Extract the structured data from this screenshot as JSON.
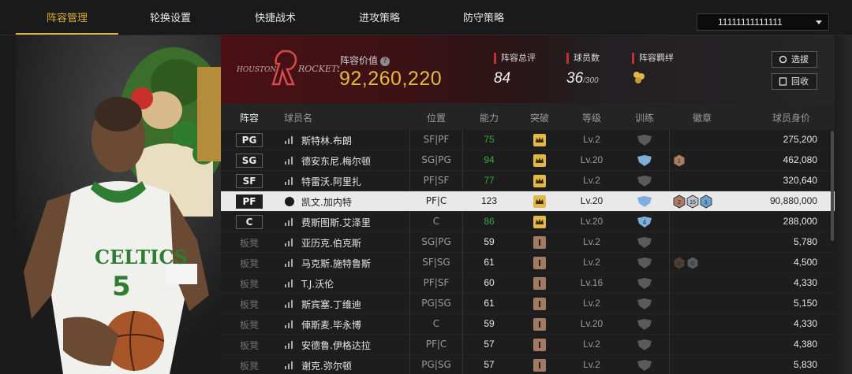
{
  "nav": {
    "tabs": [
      "阵容管理",
      "轮换设置",
      "快捷战术",
      "进攻策略",
      "防守策略"
    ],
    "active": 0,
    "dropdown_value": "11111111111111"
  },
  "team": {
    "logo_text": "HOUSTON ROCKETS",
    "value_label": "阵容价值",
    "value": "92,260,220",
    "stats": [
      {
        "label": "阵容总评",
        "value": "84",
        "suffix": ""
      },
      {
        "label": "球员数",
        "value": "36",
        "suffix": "/300"
      },
      {
        "label": "阵容羁绊",
        "value": "",
        "suffix": ""
      }
    ],
    "buttons": [
      "选拔",
      "回收"
    ]
  },
  "table": {
    "headers": [
      "阵容",
      "球员名",
      "位置",
      "能力",
      "突破",
      "等级",
      "训练",
      "徽章",
      "球员身价"
    ],
    "rows": [
      {
        "slot": "PG",
        "starter": true,
        "name": "斯特林.布朗",
        "pos": "SF|PF",
        "ability": "75",
        "ability_color": "green",
        "breakthrough": "gold",
        "level": "Lv.2",
        "training": "grey",
        "training_num": "",
        "badges": [],
        "salary": "275,200",
        "selected": false
      },
      {
        "slot": "SG",
        "starter": true,
        "name": "德安东尼.梅尔顿",
        "pos": "SG|PG",
        "ability": "94",
        "ability_color": "green",
        "breakthrough": "gold",
        "level": "Lv.20",
        "training": "blue",
        "training_num": "",
        "badges": [
          {
            "type": "bronze",
            "n": "1"
          }
        ],
        "salary": "462,080",
        "selected": false
      },
      {
        "slot": "SF",
        "starter": true,
        "name": "特雷沃.阿里扎",
        "pos": "PF|SF",
        "ability": "77",
        "ability_color": "green",
        "breakthrough": "gold",
        "level": "Lv.2",
        "training": "grey",
        "training_num": "",
        "badges": [],
        "salary": "320,640",
        "selected": false
      },
      {
        "slot": "PF",
        "starter": true,
        "name": "凯文.加内特",
        "pos": "PF|C",
        "ability": "123",
        "ability_color": "white",
        "breakthrough": "gold",
        "level": "Lv.20",
        "training": "blue",
        "training_num": "",
        "badges": [
          {
            "type": "bronze",
            "n": "2"
          },
          {
            "type": "silver",
            "n": "15"
          },
          {
            "type": "blue",
            "n": "1"
          }
        ],
        "salary": "90,880,000",
        "selected": true
      },
      {
        "slot": "C",
        "starter": true,
        "name": "费斯图斯.艾泽里",
        "pos": "C",
        "ability": "86",
        "ability_color": "green",
        "breakthrough": "gold",
        "level": "Lv.20",
        "training": "blue",
        "training_num": "4",
        "badges": [],
        "salary": "288,000",
        "selected": false
      },
      {
        "slot": "板凳",
        "starter": false,
        "name": "亚历克.伯克斯",
        "pos": "SG|PG",
        "ability": "59",
        "ability_color": "white",
        "breakthrough": "bronze",
        "level": "Lv.2",
        "training": "grey",
        "training_num": "",
        "badges": [],
        "salary": "5,780",
        "selected": false
      },
      {
        "slot": "板凳",
        "starter": false,
        "name": "马克斯.施特鲁斯",
        "pos": "SF|SG",
        "ability": "61",
        "ability_color": "white",
        "breakthrough": "bronze",
        "level": "Lv.2",
        "training": "grey",
        "training_num": "",
        "badges": [
          {
            "type": "dark-bronze",
            "n": "0"
          },
          {
            "type": "dark-silver",
            "n": "0"
          }
        ],
        "salary": "4,500",
        "selected": false
      },
      {
        "slot": "板凳",
        "starter": false,
        "name": "T.J.沃伦",
        "pos": "PF|SF",
        "ability": "60",
        "ability_color": "white",
        "breakthrough": "bronze",
        "level": "Lv.16",
        "training": "grey",
        "training_num": "",
        "badges": [],
        "salary": "4,330",
        "selected": false
      },
      {
        "slot": "板凳",
        "starter": false,
        "name": "斯宾塞.丁维迪",
        "pos": "PG|SG",
        "ability": "61",
        "ability_color": "white",
        "breakthrough": "bronze",
        "level": "Lv.2",
        "training": "grey",
        "training_num": "",
        "badges": [],
        "salary": "5,150",
        "selected": false
      },
      {
        "slot": "板凳",
        "starter": false,
        "name": "俥斯麦.毕永博",
        "pos": "C",
        "ability": "59",
        "ability_color": "white",
        "breakthrough": "bronze",
        "level": "Lv.20",
        "training": "grey",
        "training_num": "",
        "badges": [],
        "salary": "4,330",
        "selected": false
      },
      {
        "slot": "板凳",
        "starter": false,
        "name": "安德鲁.伊格达拉",
        "pos": "PF|C",
        "ability": "57",
        "ability_color": "white",
        "breakthrough": "bronze",
        "level": "Lv.2",
        "training": "grey",
        "training_num": "",
        "badges": [],
        "salary": "4,380",
        "selected": false
      },
      {
        "slot": "板凳",
        "starter": false,
        "name": "谢克.弥尔顿",
        "pos": "PG|SG",
        "ability": "57",
        "ability_color": "white",
        "breakthrough": "bronze",
        "level": "Lv.2",
        "training": "grey",
        "training_num": "",
        "badges": [],
        "salary": "5,830",
        "selected": false
      }
    ]
  },
  "player_card": {
    "jersey_text": "CELTICS",
    "number": "5"
  },
  "colors": {
    "accent": "#d9b23a",
    "red": "#c43131",
    "green": "#3fa63f"
  }
}
